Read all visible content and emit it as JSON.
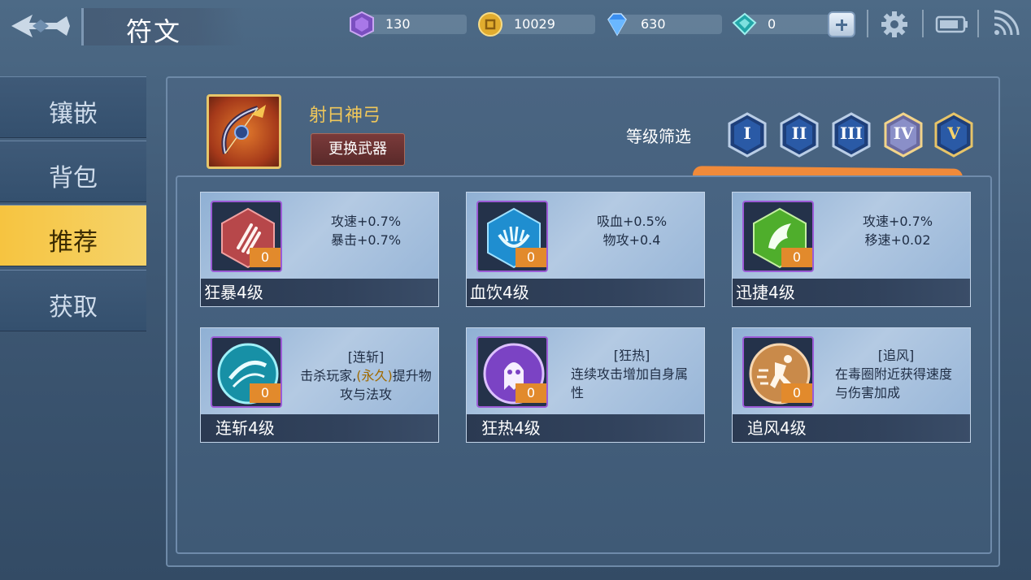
{
  "header": {
    "title": "符文",
    "resources": [
      {
        "icon": "purple-gem-icon",
        "value": "130",
        "color": "#8c5cc8"
      },
      {
        "icon": "gold-coin-icon",
        "value": "10029",
        "color": "#e5b53a"
      },
      {
        "icon": "diamond-icon",
        "value": "630",
        "color": "#4aa2ff"
      },
      {
        "icon": "ticket-icon",
        "value": "0",
        "color": "#3fc4c4"
      }
    ]
  },
  "nav": {
    "items": [
      {
        "label": "镶嵌",
        "active": false
      },
      {
        "label": "背包",
        "active": false
      },
      {
        "label": "推荐",
        "active": true
      },
      {
        "label": "获取",
        "active": false
      }
    ]
  },
  "weapon": {
    "name": "射日神弓",
    "swap_label": "更换武器"
  },
  "filter": {
    "label": "等级筛选",
    "levels": [
      "I",
      "II",
      "III",
      "IV",
      "V"
    ],
    "selected": "IV"
  },
  "runes": [
    {
      "name": "狂暴4级",
      "count": "0",
      "level_badge": "IV",
      "icon": "rage-claw-icon",
      "lines": [
        "攻速+0.7%",
        "暴击+0.7%"
      ],
      "color": "#d84a4a"
    },
    {
      "name": "血饮4级",
      "count": "0",
      "level_badge": "IV",
      "icon": "blood-drink-icon",
      "lines": [
        "吸血+0.5%",
        "物攻+0.4"
      ],
      "color": "#2ca7e0"
    },
    {
      "name": "迅捷4级",
      "count": "0",
      "level_badge": "IV",
      "icon": "swift-feather-icon",
      "lines": [
        "攻速+0.7%",
        "移速+0.02"
      ],
      "color": "#5cbf3a"
    },
    {
      "name": "连斩4级",
      "count": "0",
      "level_badge": "IV",
      "icon": "combo-slash-icon",
      "title": "[连斩]",
      "desc_parts": [
        "击杀玩家,",
        "(永久)",
        "提升物攻与法攻"
      ],
      "color": "#2bb6c8"
    },
    {
      "name": "狂热4级",
      "count": "0",
      "level_badge": "IV",
      "icon": "frenzy-ghost-icon",
      "title": "[狂热]",
      "desc": "连续攻击增加自身属性",
      "color": "#9a5ae0"
    },
    {
      "name": "追风4级",
      "count": "0",
      "level_badge": "IV",
      "icon": "chase-wind-icon",
      "title": "[追风]",
      "desc": "在毒圈附近获得速度与伤害加成",
      "color": "#d89a5a"
    }
  ]
}
